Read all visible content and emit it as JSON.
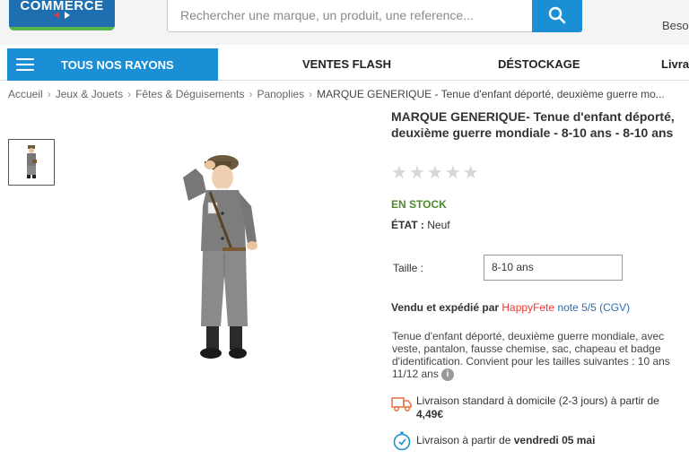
{
  "header": {
    "logo_text": "COMMERCE",
    "search_placeholder": "Rechercher une marque, un produit, une reference...",
    "account_label": "Beso"
  },
  "nav": {
    "rayons_label": "TOUS NOS RAYONS",
    "links": [
      "VENTES FLASH",
      "DÉSTOCKAGE",
      "Livrai"
    ]
  },
  "breadcrumb": [
    "Accueil",
    "Jeux & Jouets",
    "Fêtes & Déguisements",
    "Panoplies",
    "MARQUE GENERIQUE - Tenue d'enfant déporté, deuxième guerre mo..."
  ],
  "product": {
    "title": "MARQUE GENERIQUE- Tenue d'enfant déporté, deuxième guerre mondiale - 8-10 ans - 8-10 ans",
    "rating": 0,
    "rating_max": 5,
    "stock": "EN STOCK",
    "etat_label": "ÉTAT :",
    "etat_value": "Neuf",
    "taille_label": "Taille :",
    "taille_value": "8-10 ans",
    "vendu_label": "Vendu et expédié par",
    "seller": "HappyFete",
    "note": "note 5/5 (CGV)",
    "description": "Tenue d'enfant déporté, deuxième guerre mondiale, avec veste, pantalon, fausse chemise, sac, chapeau et badge d'identification. Convient pour les tailles suivantes : 10 ans 11/12 ans",
    "delivery_standard_text": "Livraison standard à domicile (2-3 jours) à partir de",
    "delivery_standard_price": "4,49€",
    "delivery_date_text": "Livraison à partir de",
    "delivery_date": "vendredi 05 mai"
  },
  "colors": {
    "brand_blue": "#1b8fd6",
    "logo_blue": "#1f6fb0",
    "stock_green": "#4a8a2b",
    "seller_red": "#e53935",
    "star_empty": "#d6d6d6"
  },
  "icons": [
    "search-icon",
    "menu-icon",
    "star-icon",
    "info-icon",
    "truck-icon",
    "stopwatch-icon",
    "carrefour-logo-icon"
  ]
}
